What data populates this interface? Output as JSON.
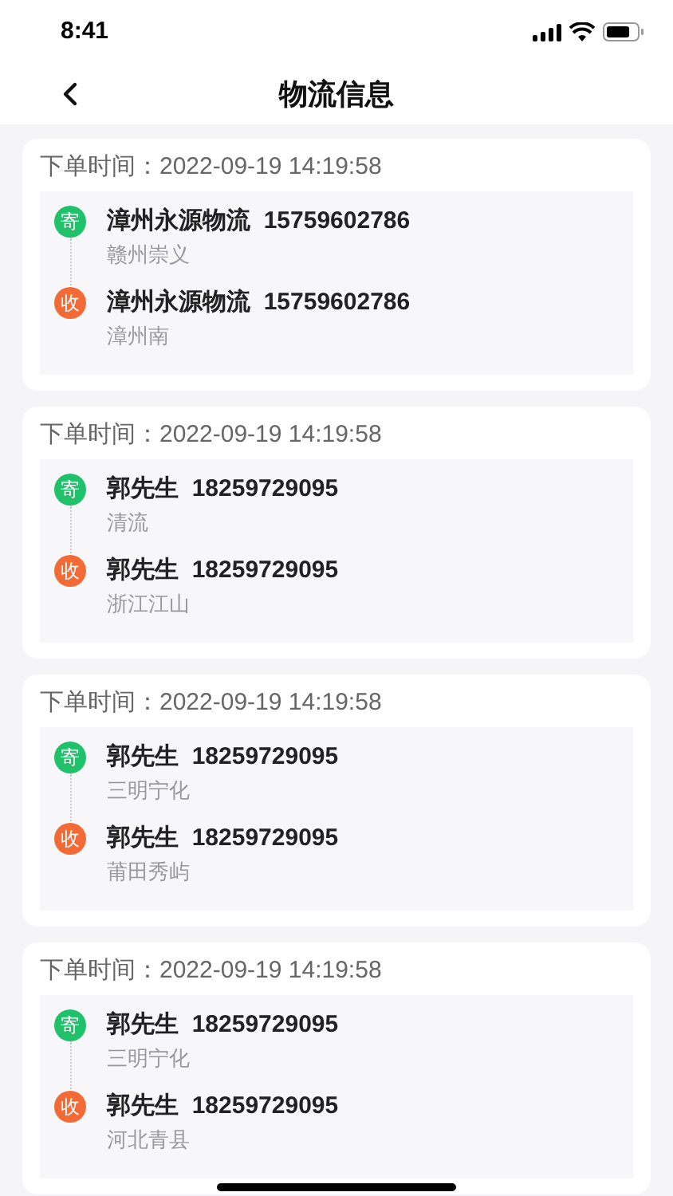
{
  "status_bar": {
    "time": "8:41"
  },
  "nav": {
    "title": "物流信息"
  },
  "orders": [
    {
      "time_label": "下单时间：",
      "time": "2022-09-19 14:19:58",
      "parties": [
        {
          "kind": "sender",
          "badge": "寄",
          "name": "漳州永源物流  15759602786",
          "place": "赣州崇义"
        },
        {
          "kind": "receiver",
          "badge": "收",
          "name": "漳州永源物流  15759602786",
          "place": "漳州南"
        }
      ]
    },
    {
      "time_label": "下单时间：",
      "time": "2022-09-19 14:19:58",
      "parties": [
        {
          "kind": "sender",
          "badge": "寄",
          "name": "郭先生  18259729095",
          "place": "清流"
        },
        {
          "kind": "receiver",
          "badge": "收",
          "name": "郭先生  18259729095",
          "place": "浙江江山"
        }
      ]
    },
    {
      "time_label": "下单时间：",
      "time": "2022-09-19 14:19:58",
      "parties": [
        {
          "kind": "sender",
          "badge": "寄",
          "name": "郭先生  18259729095",
          "place": "三明宁化"
        },
        {
          "kind": "receiver",
          "badge": "收",
          "name": "郭先生  18259729095",
          "place": "莆田秀屿"
        }
      ]
    },
    {
      "time_label": "下单时间：",
      "time": "2022-09-19 14:19:58",
      "parties": [
        {
          "kind": "sender",
          "badge": "寄",
          "name": "郭先生  18259729095",
          "place": "三明宁化"
        },
        {
          "kind": "receiver",
          "badge": "收",
          "name": "郭先生  18259729095",
          "place": "河北青县"
        }
      ]
    }
  ]
}
